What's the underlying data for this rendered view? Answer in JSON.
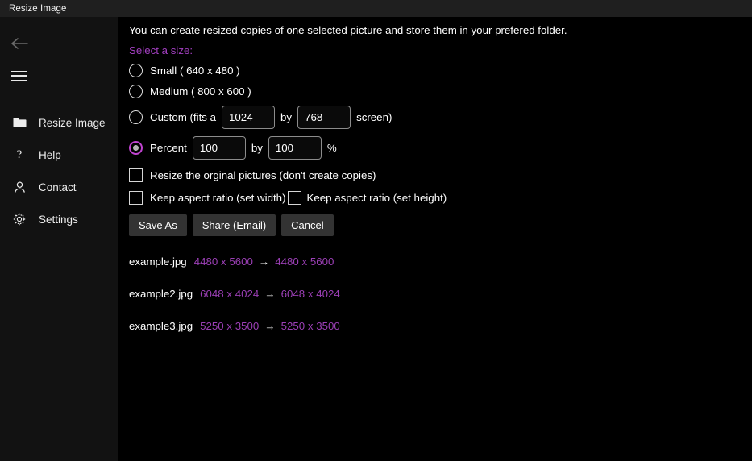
{
  "window": {
    "title": "Resize Image"
  },
  "colors": {
    "accent_purple": "#a23fc0",
    "dimension_purple": "#9b3fb5",
    "radio_selected_ring": "#c043d0",
    "titlebar_bg": "#1f1f1f",
    "sidebar_bg": "#121212",
    "content_bg": "#000000",
    "button_bg": "#333333"
  },
  "sidebar": {
    "back_icon": "back-arrow-icon",
    "menu_icon": "hamburger-menu-icon",
    "items": [
      {
        "label": "Resize Image",
        "icon": "folder-icon"
      },
      {
        "label": "Help",
        "icon": "question-mark-icon"
      },
      {
        "label": "Contact",
        "icon": "person-icon"
      },
      {
        "label": "Settings",
        "icon": "gear-icon"
      }
    ]
  },
  "main": {
    "intro": "You can create resized copies of one selected picture and store them in your prefered folder.",
    "section_label": "Select a size:",
    "size_options": [
      {
        "label": "Small ( 640 x 480 )",
        "selected": false
      },
      {
        "label": "Medium ( 800 x 600 )",
        "selected": false
      }
    ],
    "custom": {
      "label_before": "Custom (fits a",
      "width_value": "1024",
      "between": "by",
      "height_value": "768",
      "label_after": "screen)",
      "selected": false
    },
    "percent": {
      "label": "Percent",
      "width_value": "100",
      "between": "by",
      "height_value": "100",
      "suffix": "%",
      "selected": true
    },
    "checkboxes": [
      {
        "label": "Resize the orginal pictures (don't create copies)",
        "checked": false
      },
      {
        "label": "Keep aspect ratio (set width)",
        "checked": false
      },
      {
        "label": "Keep aspect ratio (set height)",
        "checked": false
      }
    ],
    "buttons": [
      {
        "label": "Save As"
      },
      {
        "label": "Share (Email)"
      },
      {
        "label": "Cancel"
      }
    ],
    "arrow_glyph": "→",
    "files": [
      {
        "name": "example.jpg",
        "source": "4480 x 5600",
        "target": "4480 x 5600"
      },
      {
        "name": "example2.jpg",
        "source": "6048 x 4024",
        "target": "6048 x 4024"
      },
      {
        "name": "example3.jpg",
        "source": "5250 x 3500",
        "target": "5250 x 3500"
      }
    ]
  }
}
